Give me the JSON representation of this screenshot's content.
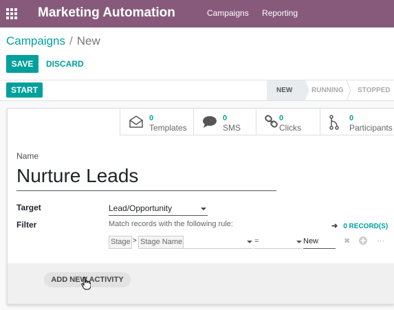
{
  "navbar": {
    "app_title": "Marketing Automation",
    "menu": [
      "Campaigns",
      "Reporting"
    ]
  },
  "breadcrumb": {
    "parent": "Campaigns",
    "separator": "/",
    "current": "New"
  },
  "toolbar": {
    "save_label": "SAVE",
    "discard_label": "DISCARD"
  },
  "header": {
    "start_label": "START",
    "stages": [
      {
        "label": "NEW",
        "active": true
      },
      {
        "label": "RUNNING",
        "active": false
      },
      {
        "label": "STOPPED",
        "active": false
      }
    ]
  },
  "stat_buttons": [
    {
      "count": "0",
      "label": "Templates",
      "icon": "envelope-icon"
    },
    {
      "count": "0",
      "label": "SMS",
      "icon": "comment-icon"
    },
    {
      "count": "0",
      "label": "Clicks",
      "icon": "link-icon"
    },
    {
      "count": "0",
      "label": "Participants",
      "icon": "code-fork-icon"
    }
  ],
  "form": {
    "name_label": "Name",
    "name_value": "Nurture Leads",
    "target_label": "Target",
    "target_value": "Lead/Opportunity",
    "filter_label": "Filter",
    "filter_rule_text": "Match records with the following rule:",
    "records_label": "0 RECORD(S)",
    "domain": {
      "field_chain": [
        "Stage",
        "Stage Name"
      ],
      "chain_separator": ">",
      "operator": "=",
      "value": "New"
    },
    "add_activity_label": "ADD NEW ACTIVITY"
  },
  "colors": {
    "navbar": "#875a7b",
    "primary": "#00a09d"
  }
}
